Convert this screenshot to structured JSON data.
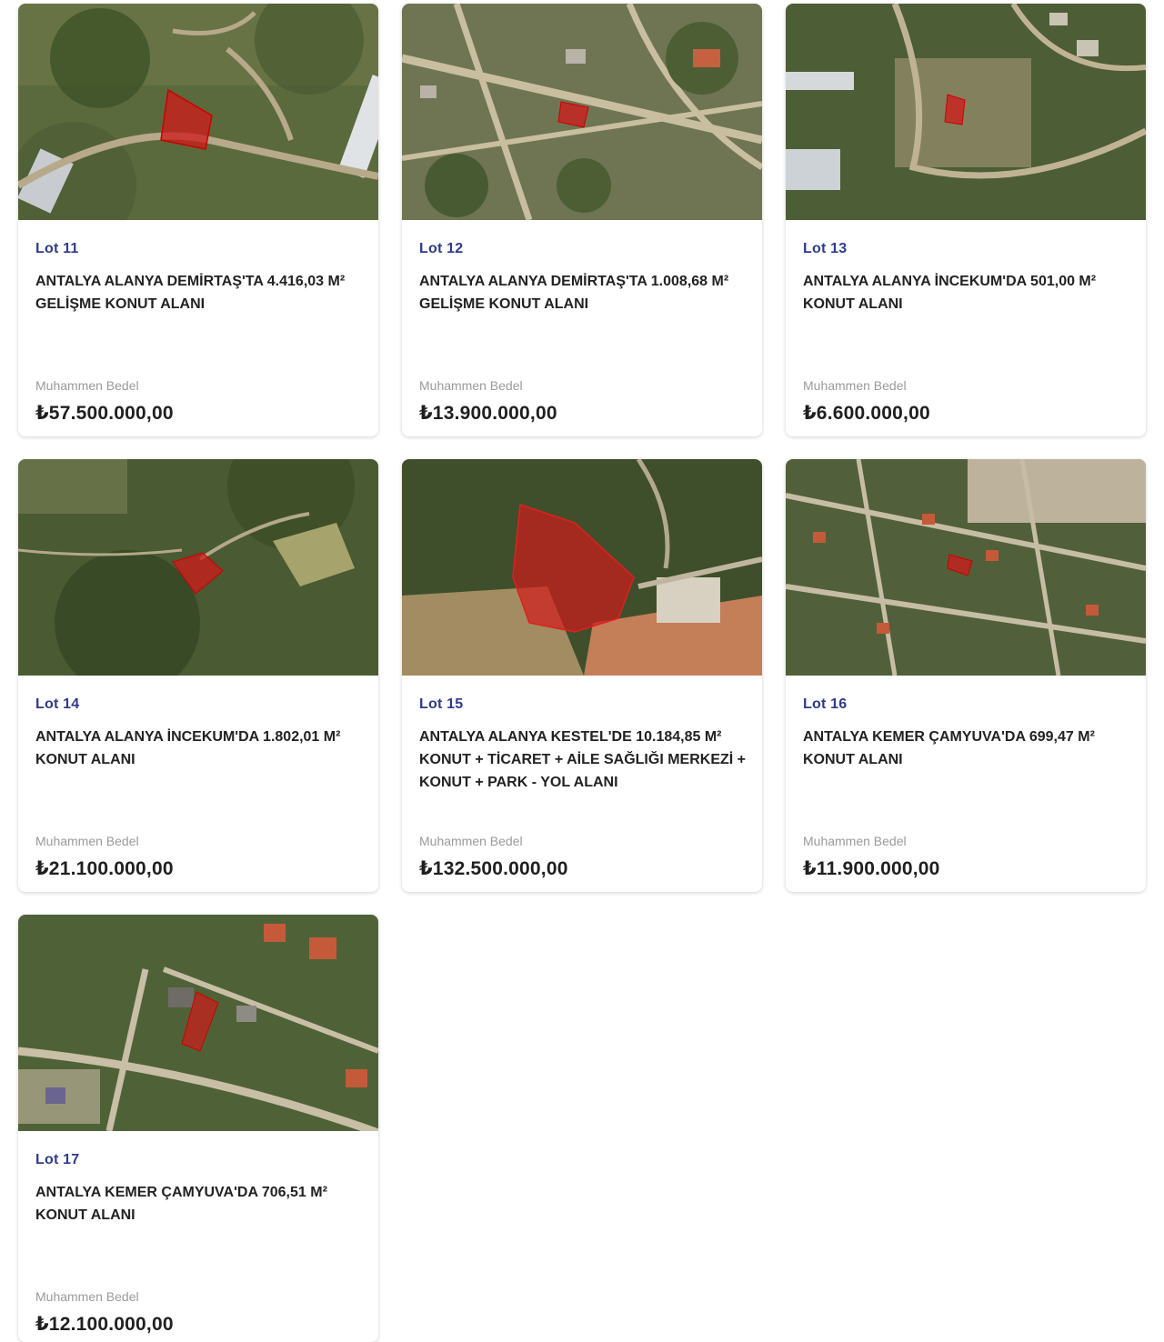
{
  "lots": [
    {
      "lot": "Lot 11",
      "title": "ANTALYA ALANYA DEMİRTAŞ'TA 4.416,03 M² GELİŞME KONUT ALANI",
      "label": "Muhammen Bedel",
      "price": "₺57.500.000,00"
    },
    {
      "lot": "Lot 12",
      "title": "ANTALYA ALANYA DEMİRTAŞ'TA 1.008,68 M² GELİŞME KONUT ALANI",
      "label": "Muhammen Bedel",
      "price": "₺13.900.000,00"
    },
    {
      "lot": "Lot 13",
      "title": "ANTALYA ALANYA İNCEKUM'DA 501,00 M² KONUT ALANI",
      "label": "Muhammen Bedel",
      "price": "₺6.600.000,00"
    },
    {
      "lot": "Lot 14",
      "title": "ANTALYA ALANYA İNCEKUM'DA 1.802,01 M² KONUT ALANI",
      "label": "Muhammen Bedel",
      "price": "₺21.100.000,00"
    },
    {
      "lot": "Lot 15",
      "title": "ANTALYA ALANYA KESTEL'DE 10.184,85 M² KONUT + TİCARET + AİLE SAĞLIĞI MERKEZİ + KONUT + PARK - YOL ALANI",
      "label": "Muhammen Bedel",
      "price": "₺132.500.000,00"
    },
    {
      "lot": "Lot 16",
      "title": "ANTALYA KEMER ÇAMYUVA'DA 699,47 M² KONUT ALANI",
      "label": "Muhammen Bedel",
      "price": "₺11.900.000,00"
    },
    {
      "lot": "Lot 17",
      "title": "ANTALYA KEMER ÇAMYUVA'DA 706,51 M² KONUT ALANI",
      "label": "Muhammen Bedel",
      "price": "₺12.100.000,00"
    }
  ],
  "colors": {
    "lot_accent": "#2f3a8f",
    "parcel_highlight": "#d01a1a"
  }
}
